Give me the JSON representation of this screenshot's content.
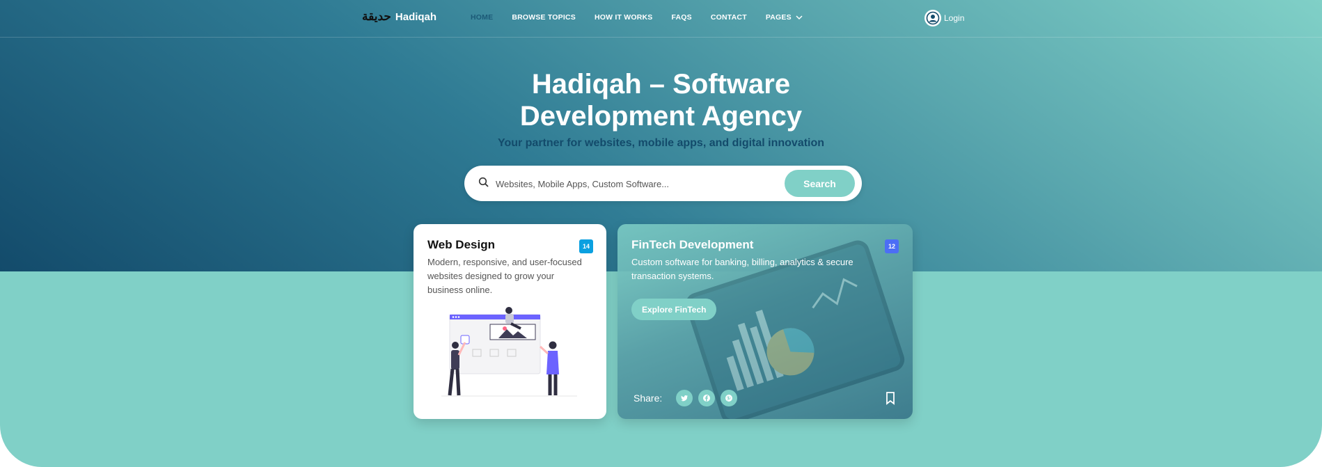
{
  "nav": {
    "logo_arabic": "حديقة",
    "logo_text": "Hadiqah",
    "items": [
      {
        "label": "HOME"
      },
      {
        "label": "BROWSE TOPICS"
      },
      {
        "label": "HOW IT WORKS"
      },
      {
        "label": "FAQS"
      },
      {
        "label": "CONTACT"
      },
      {
        "label": "PAGES"
      }
    ],
    "login_label": "Login"
  },
  "hero": {
    "title_line1": "Hadiqah – Software",
    "title_line2": "Development Agency",
    "subtitle": "Your partner for websites, mobile apps, and digital innovation"
  },
  "search": {
    "placeholder": "Websites, Mobile Apps, Custom Software...",
    "button_label": "Search"
  },
  "cards": [
    {
      "title": "Web Design",
      "badge": "14",
      "description": "Modern, responsive, and user-focused websites designed to grow your business online."
    },
    {
      "title": "FinTech Development",
      "badge": "12",
      "description": "Custom software for banking, billing, analytics & secure transaction systems.",
      "button_label": "Explore FinTech",
      "share_label": "Share:"
    }
  ],
  "colors": {
    "accent": "#80d0c7",
    "deep": "#134b6b",
    "badge_web": "#0aa0e0",
    "badge_fin": "#4c6ef5"
  }
}
